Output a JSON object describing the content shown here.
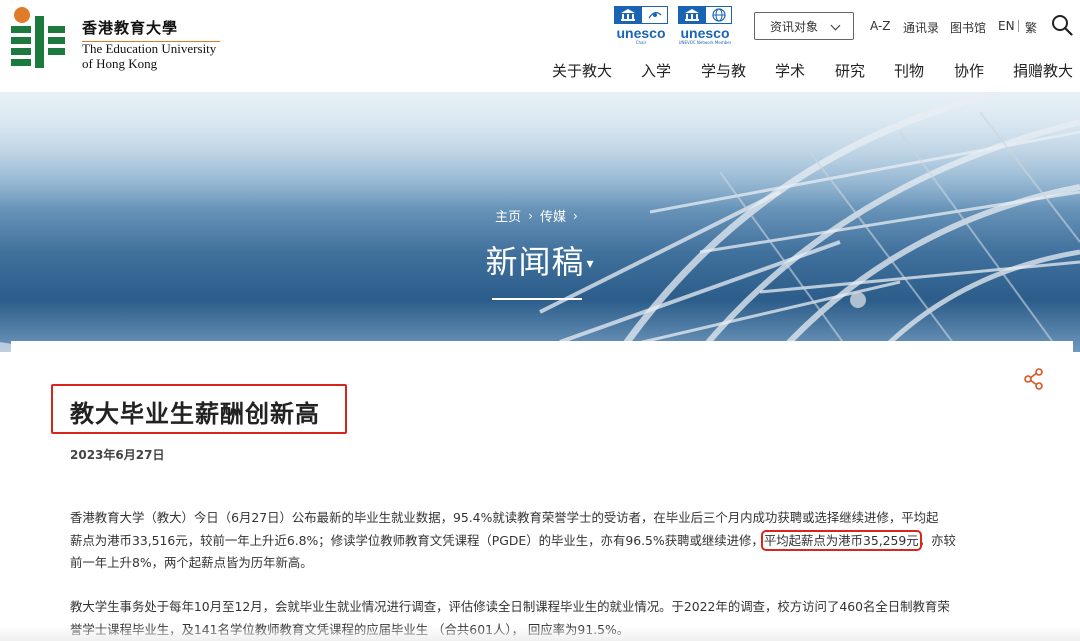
{
  "logo": {
    "name_cn": "香港教育大學",
    "name_en_line1": "The Education University",
    "name_en_line2": "of Hong Kong"
  },
  "unesco_badges": [
    {
      "word": "unesco",
      "sub": "Chair"
    },
    {
      "word": "unesco",
      "sub": "UNEVOC Network Member"
    }
  ],
  "top_bar": {
    "resource_select": "资讯对象",
    "links": [
      "A-Z",
      "通讯录",
      "图书馆",
      "EN",
      "繁"
    ]
  },
  "nav": [
    "关于教大",
    "入学",
    "学与教",
    "学术",
    "研究",
    "刊物",
    "协作",
    "捐赠教大"
  ],
  "banner": {
    "breadcrumb": [
      "主页",
      "传媒"
    ],
    "title": "新闻稿",
    "caret": "▾"
  },
  "article": {
    "title": "教大毕业生薪酬创新高",
    "date": "2023年6月27日",
    "para1_line1": "香港教育大学（教大）今日（6月27日）公布最新的毕业生就业数据，95.4%就读教育荣誉学士的受访者，在毕业后三个月内成功获聘或选择继续进修，平均起",
    "para1_line2_before": "薪点为港币33,516元，较前一年上升近6.8%；修读学位教师教育文凭课程（PGDE）的毕业生，亦有96.5%获聘或继续进修，",
    "para1_highlight": "平均起薪点为港币35,259元",
    "para1_line2_after": "，亦较",
    "para1_line3": "前一年上升8%，两个起薪点皆为历年新高。",
    "para2_line1": "教大学生事务处于每年10月至12月，会就毕业生就业情况进行调查，评估修读全日制课程毕业生的就业情况。于2022年的调查，校方访问了460名全日制教育荣",
    "para2_line2": "誉学士课程毕业生，及141名学位教师教育文凭课程的应届毕业生 （合共601人）， 回应率为91.5%。"
  },
  "colors": {
    "accent_red": "#d8261e",
    "logo_green": "#1d7a3e",
    "logo_orange": "#e07b2a",
    "unesco_blue": "#1b64b4",
    "share_orange": "#d9531e"
  }
}
